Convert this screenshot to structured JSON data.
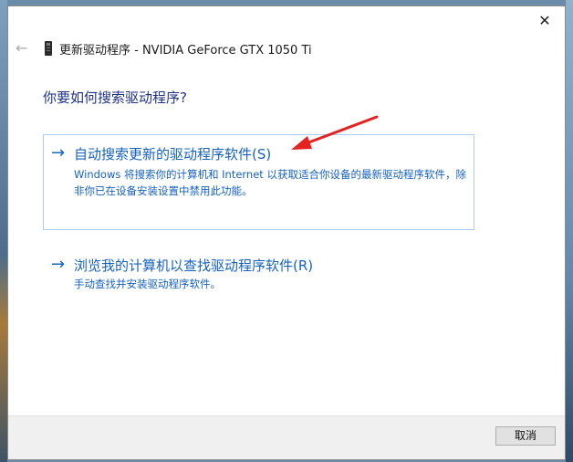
{
  "window": {
    "title": "更新驱动程序 - NVIDIA GeForce GTX 1050 Ti",
    "close_glyph": "✕",
    "back_glyph": "←"
  },
  "question": "你要如何搜索驱动程序?",
  "options": [
    {
      "arrow": "→",
      "title": "自动搜索更新的驱动程序软件(S)",
      "description": "Windows 将搜索你的计算机和 Internet 以获取适合你设备的最新驱动程序软件，除非你已在设备安装设置中禁用此功能。"
    },
    {
      "arrow": "→",
      "title": "浏览我的计算机以查找驱动程序软件(R)",
      "description": "手动查找并安装驱动程序软件。"
    }
  ],
  "footer": {
    "cancel_label": "取消"
  },
  "icons": {
    "device": "gpu-device-icon",
    "annotation": "red-arrow-annotation"
  },
  "colors": {
    "link_blue": "#1662c0",
    "heading_blue": "#1e3287",
    "annotation_red": "#e52222"
  }
}
